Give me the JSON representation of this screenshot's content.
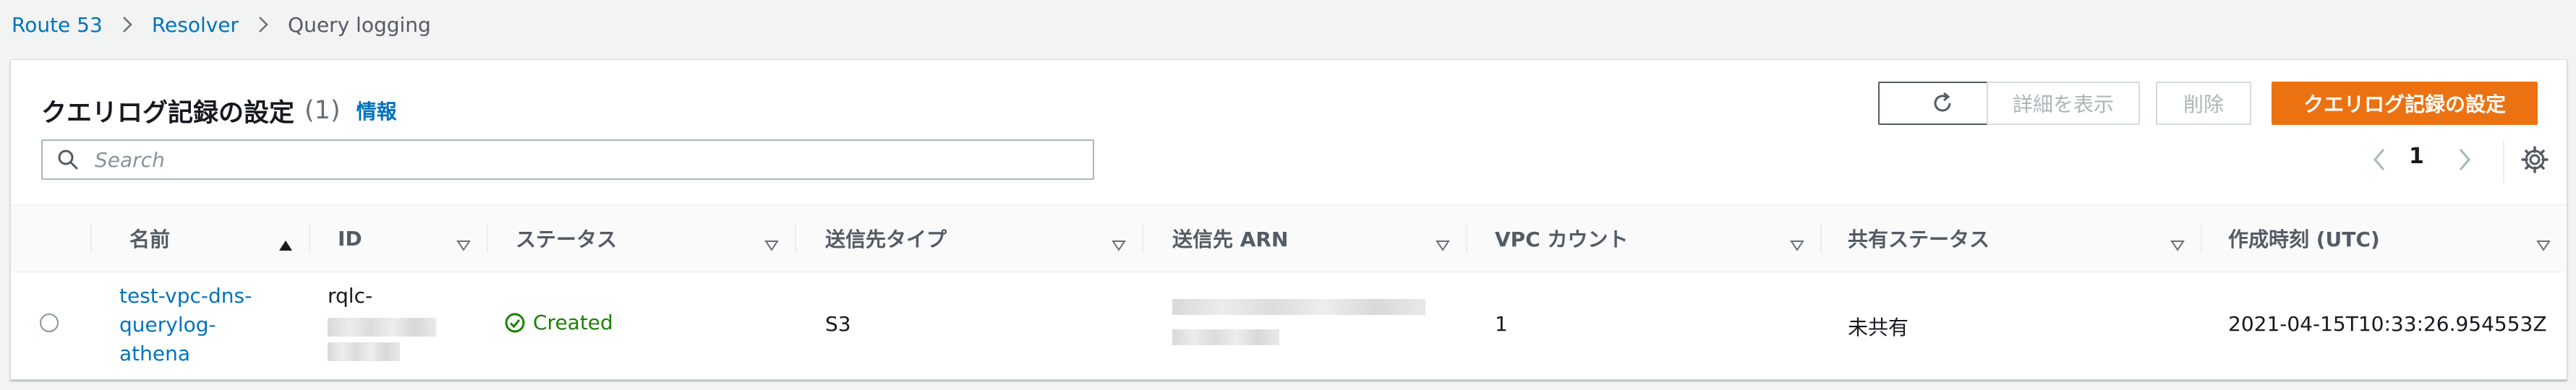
{
  "breadcrumb": {
    "items": [
      "Route 53",
      "Resolver"
    ],
    "current": "Query logging"
  },
  "header": {
    "title": "クエリログ記録の設定",
    "count": "(1)",
    "info": "情報"
  },
  "actions": {
    "details": "詳細を表示",
    "delete": "削除",
    "create": "クエリログ記録の設定"
  },
  "search": {
    "placeholder": "Search"
  },
  "pagination": {
    "current_page": "1"
  },
  "table": {
    "columns": [
      "名前",
      "ID",
      "ステータス",
      "送信先タイプ",
      "送信先 ARN",
      "VPC カウント",
      "共有ステータス",
      "作成時刻 (UTC)"
    ],
    "rows": [
      {
        "name": "test-vpc-dns-querylog-athena",
        "name_lines": [
          "test-vpc-dns-",
          "querylog-",
          "athena"
        ],
        "id": "rqlc-",
        "status": "Created",
        "destination_type": "S3",
        "destination_arn": "",
        "vpc_count": "1",
        "share_status": "未共有",
        "created": "2021-04-15T10:33:26.954553Z"
      }
    ]
  },
  "colors": {
    "link": "#0073bb",
    "primary": "#ec7211",
    "success": "#1d8102",
    "disabled": "#aab7b8"
  },
  "icons": [
    "chevron-right-icon",
    "refresh-icon",
    "search-icon",
    "chevron-left-icon",
    "settings-icon",
    "sort-ascending-icon",
    "sort-icon",
    "status-success-icon"
  ]
}
